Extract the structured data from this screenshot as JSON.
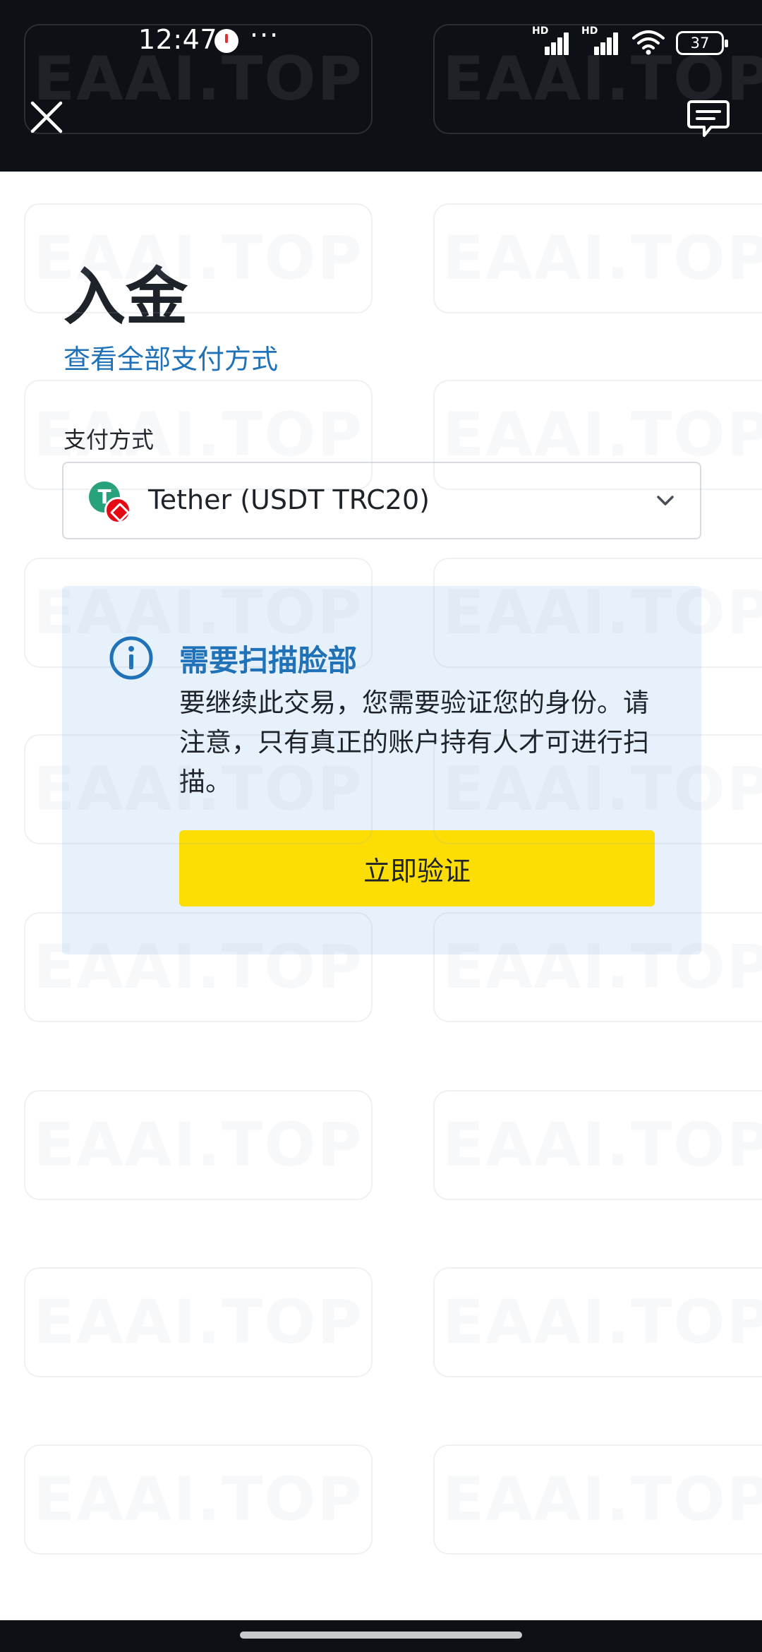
{
  "status_bar": {
    "time": "12:47",
    "more": "···",
    "network_badge_1": "HD",
    "network_badge_2": "HD",
    "battery": "37"
  },
  "header": {
    "close_icon": "close-icon",
    "chat_icon": "chat-bubble-icon"
  },
  "page": {
    "title": "入金",
    "view_all_link": "查看全部支付方式",
    "payment_label": "支付方式",
    "payment_method": {
      "value": "Tether (USDT TRC20)",
      "coin_glyph": "T",
      "icon": "chevron-down-icon"
    }
  },
  "notice": {
    "icon": "info-icon",
    "title": "需要扫描脸部",
    "body": "要继续此交易，您需要验证您的身份。请注意，只有真正的账户持有人才可进行扫描。",
    "button": "立即验证"
  },
  "watermark": "EAAI.TOP",
  "colors": {
    "header_bg": "#0d1014",
    "link_blue": "#1f72b8",
    "notice_bg": "#e7f1fb",
    "button_yellow": "#fcde05",
    "usdt_green": "#26a17b",
    "trx_red": "#e50914",
    "text_dark": "#1e2329"
  }
}
